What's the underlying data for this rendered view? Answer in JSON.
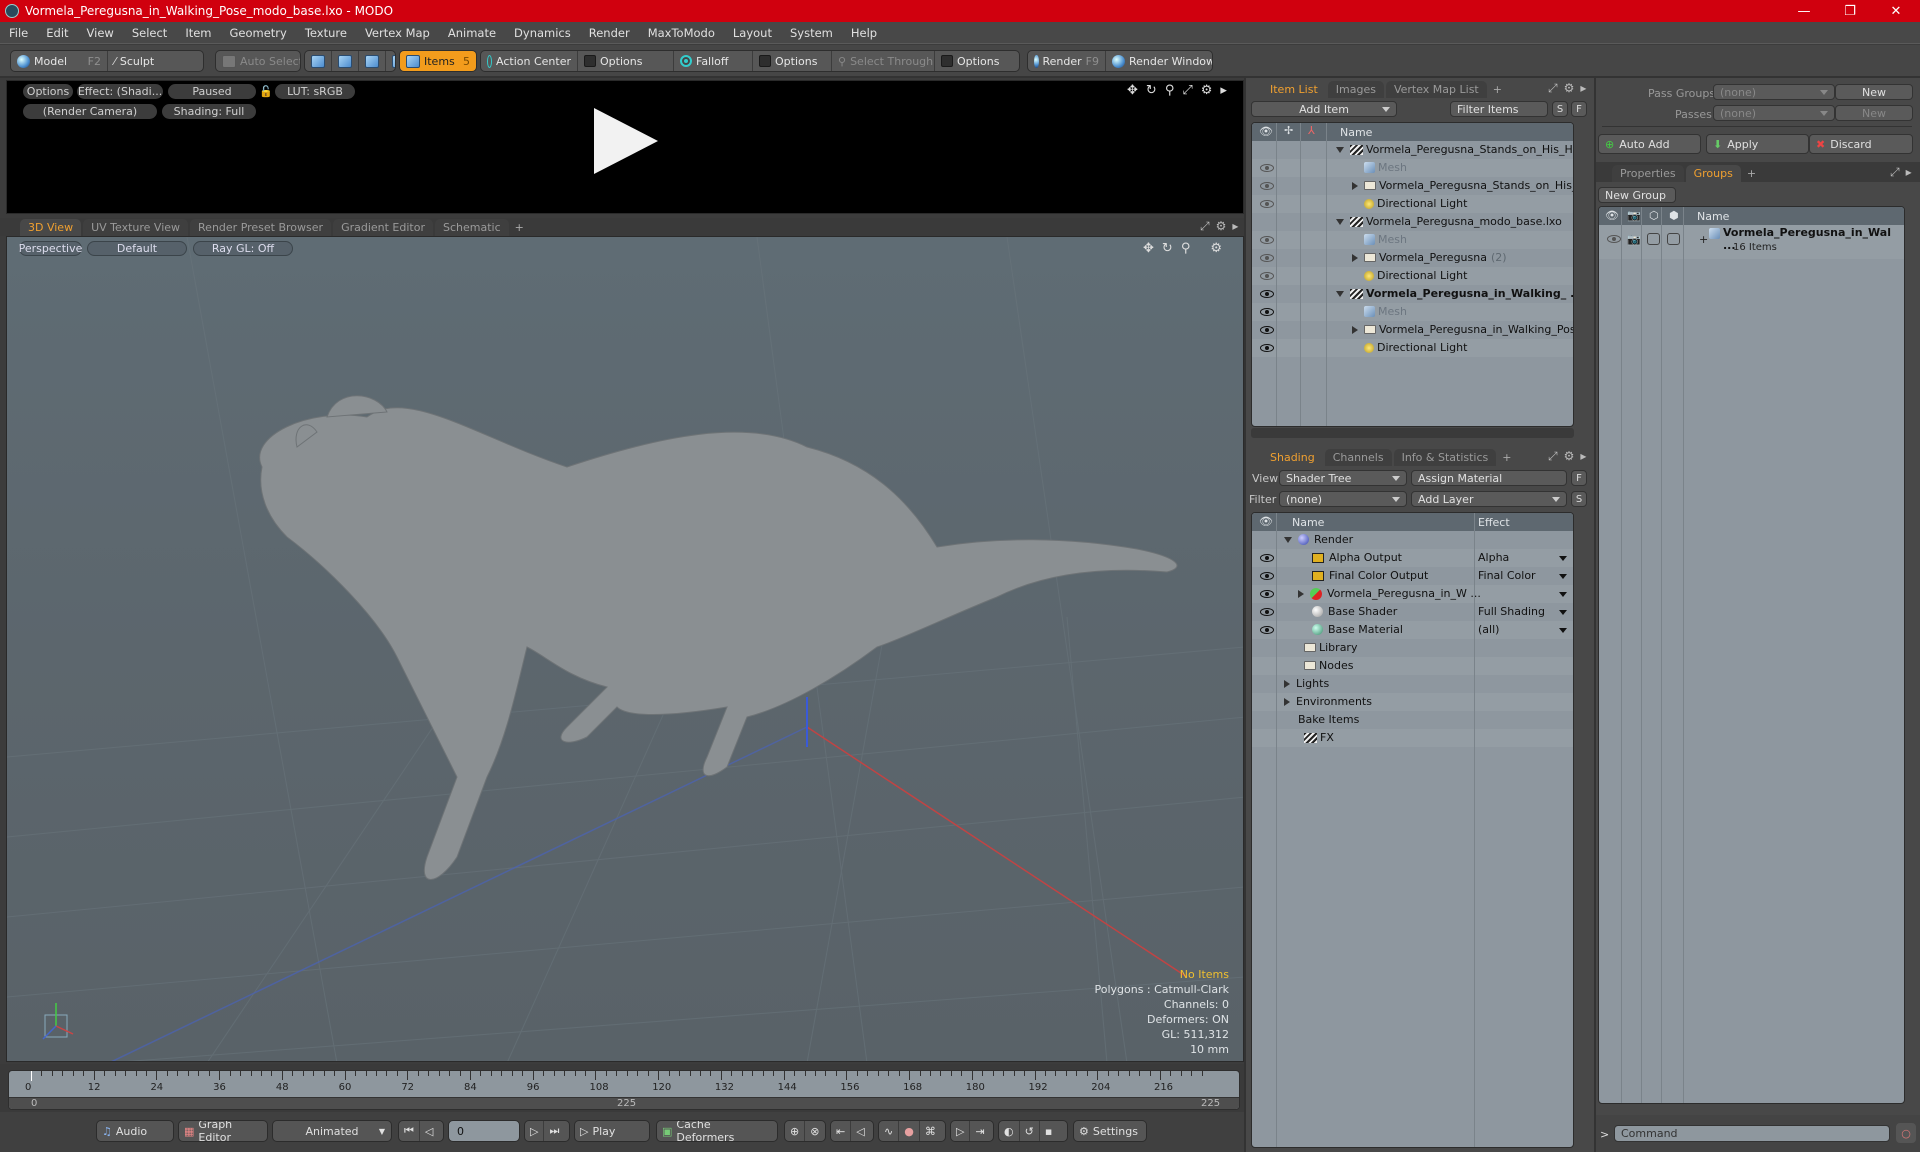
{
  "window": {
    "title": "Vormela_Peregusna_in_Walking_Pose_modo_base.lxo - MODO",
    "minimize": "—",
    "restore": "❐",
    "close": "✕"
  },
  "menu": [
    "File",
    "Edit",
    "View",
    "Select",
    "Item",
    "Geometry",
    "Texture",
    "Vertex Map",
    "Animate",
    "Dynamics",
    "Render",
    "MaxToModo",
    "Layout",
    "System",
    "Help"
  ],
  "toolbar": {
    "model": "Model",
    "model_key": "F2",
    "sculpt": "Sculpt",
    "auto_select": "Auto Select",
    "items": "Items",
    "items_count": "5",
    "action_center": "Action Center",
    "options1": "Options",
    "falloff": "Falloff",
    "options2": "Options",
    "select_through": "Select Through",
    "options3": "Options",
    "render": "Render",
    "render_key": "F9",
    "render_window": "Render Window"
  },
  "render_preview": {
    "options": "Options",
    "effect": "Effect: (Shadi...",
    "paused": "Paused",
    "lut": "LUT: sRGB",
    "camera": "(Render Camera)",
    "shading": "Shading: Full"
  },
  "viewport_tabs": [
    {
      "label": "3D View",
      "active": true
    },
    {
      "label": "UV Texture View"
    },
    {
      "label": "Render Preset Browser"
    },
    {
      "label": "Gradient Editor"
    },
    {
      "label": "Schematic"
    }
  ],
  "viewport": {
    "projection": "Perspective",
    "style": "Default",
    "raygl": "Ray GL: Off",
    "stats": {
      "selection": "No Items",
      "polygons": "Polygons : Catmull-Clark",
      "channels": "Channels: 0",
      "deformers": "Deformers: ON",
      "gl": "GL: 511,312",
      "unit": "10 mm"
    },
    "selection_color": "#f0c030"
  },
  "timeline": {
    "ticks": [
      "0",
      "12",
      "24",
      "36",
      "48",
      "60",
      "72",
      "84",
      "96",
      "108",
      "120",
      "132",
      "144",
      "156",
      "168",
      "180",
      "192",
      "204",
      "216"
    ],
    "range_start": "0",
    "range_mid": "225",
    "range_end": "225",
    "current_frame": 0,
    "max_frame": 225
  },
  "transport": {
    "audio": "Audio",
    "graph_editor": "Graph Editor",
    "mode": "Animated",
    "frame": "0",
    "play": "Play",
    "cache_deformers": "Cache Deformers",
    "settings": "Settings"
  },
  "item_list": {
    "tabs": [
      {
        "label": "Item List",
        "active": true
      },
      {
        "label": "Images"
      },
      {
        "label": "Vertex Map List"
      }
    ],
    "add_item": "Add Item",
    "filter": "Filter Items",
    "s": "S",
    "f": "F",
    "col_name": "Name",
    "rows": [
      {
        "label": "Vormela_Peregusna_Stands_on_His_Hin ...",
        "type": "scene",
        "indent": 0,
        "expanded": true,
        "eye": "none",
        "bold": false
      },
      {
        "label": "Mesh",
        "type": "mesh",
        "indent": 1,
        "eye": "dim",
        "dim": true
      },
      {
        "label": "Vormela_Peregusna_Stands_on_His_ ...",
        "type": "folder",
        "indent": 1,
        "collapsed": true,
        "eye": "dim"
      },
      {
        "label": "Directional Light",
        "type": "light",
        "indent": 1,
        "eye": "dim"
      },
      {
        "label": "Vormela_Peregusna_modo_base.lxo",
        "type": "scene",
        "indent": 0,
        "expanded": true,
        "eye": "none"
      },
      {
        "label": "Mesh",
        "type": "mesh",
        "indent": 1,
        "eye": "dim",
        "dim": true
      },
      {
        "label": "Vormela_Peregusna",
        "suffix": "(2)",
        "type": "folder",
        "indent": 1,
        "collapsed": true,
        "eye": "dim"
      },
      {
        "label": "Directional Light",
        "type": "light",
        "indent": 1,
        "eye": "dim"
      },
      {
        "label": "Vormela_Peregusna_in_Walking_ ...",
        "type": "scene",
        "indent": 0,
        "expanded": true,
        "eye": "on",
        "bold": true
      },
      {
        "label": "Mesh",
        "type": "mesh",
        "indent": 1,
        "eye": "on",
        "dim": true
      },
      {
        "label": "Vormela_Peregusna_in_Walking_Pose ...",
        "type": "folder",
        "indent": 1,
        "collapsed": true,
        "eye": "on"
      },
      {
        "label": "Directional Light",
        "type": "light",
        "indent": 1,
        "eye": "on"
      }
    ]
  },
  "shading": {
    "tabs": [
      {
        "label": "Shading",
        "active": true
      },
      {
        "label": "Channels"
      },
      {
        "label": "Info & Statistics"
      }
    ],
    "view_label": "View",
    "view_value": "Shader Tree",
    "assign_material": "Assign Material",
    "f": "F",
    "filter_label": "Filter",
    "filter_value": "(none)",
    "add_layer": "Add Layer",
    "s": "S",
    "col_name": "Name",
    "col_effect": "Effect",
    "rows": [
      {
        "label": "Render",
        "icon": "render-sphere",
        "indent": 0,
        "expanded": true,
        "eye": false,
        "effect": ""
      },
      {
        "label": "Alpha Output",
        "icon": "output",
        "indent": 1,
        "eye": true,
        "effect": "Alpha",
        "dropdown": true
      },
      {
        "label": "Final Color Output",
        "icon": "output",
        "indent": 1,
        "eye": true,
        "effect": "Final Color",
        "dropdown": true
      },
      {
        "label": "Vormela_Peregusna_in_W ...",
        "icon": "material-group",
        "indent": 1,
        "collapsed": true,
        "eye": true,
        "effect": "",
        "dropdown": true
      },
      {
        "label": "Base Shader",
        "icon": "shader",
        "indent": 1,
        "eye": true,
        "effect": "Full Shading",
        "dropdown": true
      },
      {
        "label": "Base Material",
        "icon": "material",
        "indent": 1,
        "eye": true,
        "effect": "(all)",
        "dropdown": true
      },
      {
        "label": "Library",
        "icon": "folder",
        "indent": 0.5,
        "eye": false,
        "effect": ""
      },
      {
        "label": "Nodes",
        "icon": "folder",
        "indent": 0.5,
        "eye": false,
        "effect": ""
      },
      {
        "label": "Lights",
        "icon": "none",
        "indent": 0,
        "collapsed": true,
        "eye": false,
        "effect": ""
      },
      {
        "label": "Environments",
        "icon": "none",
        "indent": 0,
        "collapsed": true,
        "eye": false,
        "effect": ""
      },
      {
        "label": "Bake Items",
        "icon": "none",
        "indent": 0,
        "eye": false,
        "effect": ""
      },
      {
        "label": "FX",
        "icon": "clap",
        "indent": 0.5,
        "eye": false,
        "effect": ""
      }
    ]
  },
  "passes": {
    "pass_groups_label": "Pass Groups",
    "pass_groups_value": "(none)",
    "new1": "New",
    "passes_label": "Passes",
    "passes_value": "(none)",
    "new2": "New",
    "auto_add": "Auto Add",
    "apply": "Apply",
    "discard": "Discard"
  },
  "groups": {
    "tabs": [
      {
        "label": "Properties"
      },
      {
        "label": "Groups",
        "active": true
      }
    ],
    "new_group": "New Group",
    "col_name": "Name",
    "rows": [
      {
        "label": "Vormela_Peregusna_in_Wal ...",
        "sub": "16 Items"
      }
    ]
  },
  "command": {
    "prompt": ">",
    "placeholder": "Command"
  }
}
